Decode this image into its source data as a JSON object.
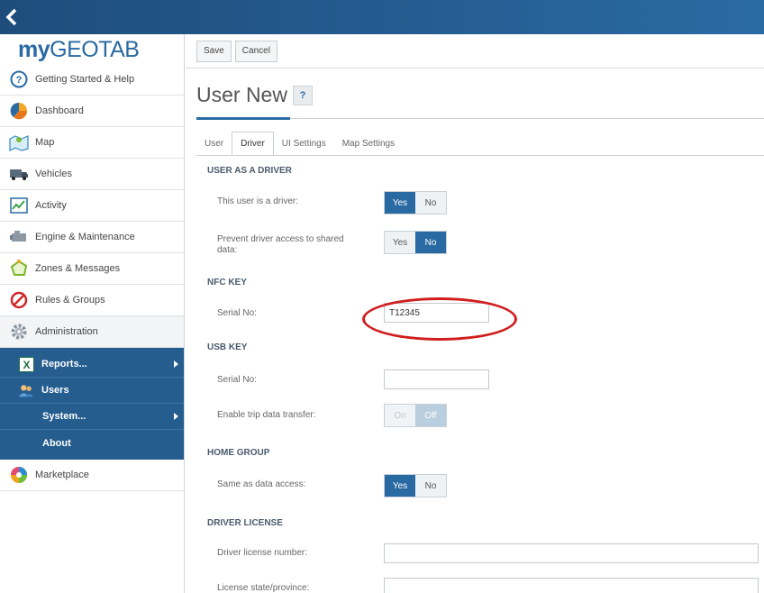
{
  "app": {
    "logo_my": "my",
    "logo_geotab": "GEOTAB"
  },
  "sidebar": {
    "items": [
      {
        "label": "Getting Started & Help",
        "icon": "help-circle-icon"
      },
      {
        "label": "Dashboard",
        "icon": "pie-chart-icon"
      },
      {
        "label": "Map",
        "icon": "map-icon"
      },
      {
        "label": "Vehicles",
        "icon": "truck-icon"
      },
      {
        "label": "Activity",
        "icon": "activity-chart-icon"
      },
      {
        "label": "Engine & Maintenance",
        "icon": "engine-icon"
      },
      {
        "label": "Zones & Messages",
        "icon": "zone-polygon-icon"
      },
      {
        "label": "Rules & Groups",
        "icon": "rules-prohibited-icon"
      },
      {
        "label": "Administration",
        "icon": "gear-icon"
      }
    ],
    "submenu": [
      {
        "label": "Reports...",
        "icon": "excel-icon",
        "has_arrow": true
      },
      {
        "label": "Users",
        "icon": "users-icon",
        "has_arrow": false
      },
      {
        "label": "System...",
        "has_arrow": true
      },
      {
        "label": "About",
        "has_arrow": false
      }
    ],
    "marketplace": "Marketplace"
  },
  "toolbar": {
    "save_label": "Save",
    "cancel_label": "Cancel"
  },
  "page": {
    "title": "User New",
    "help": "?"
  },
  "tabs": [
    {
      "label": "User"
    },
    {
      "label": "Driver",
      "active": true
    },
    {
      "label": "UI Settings"
    },
    {
      "label": "Map Settings"
    }
  ],
  "form": {
    "driver_section": "USER AS A DRIVER",
    "is_driver_label": "This user is a driver:",
    "is_driver": {
      "yes": "Yes",
      "no": "No",
      "selected": "Yes"
    },
    "prevent_access_label": "Prevent driver access to shared data:",
    "prevent_access": {
      "yes": "Yes",
      "no": "No",
      "selected": "No"
    },
    "nfc_section": "NFC KEY",
    "nfc_serial_label": "Serial No:",
    "nfc_serial_value": "T12345",
    "usb_section": "USB KEY",
    "usb_serial_label": "Serial No:",
    "usb_serial_value": "",
    "trip_transfer_label": "Enable trip data transfer:",
    "trip_transfer": {
      "on": "On",
      "off": "Off",
      "selected": "Off",
      "disabled": true
    },
    "home_section": "HOME GROUP",
    "same_access_label": "Same as data access:",
    "same_access": {
      "yes": "Yes",
      "no": "No",
      "selected": "Yes"
    },
    "license_section": "DRIVER LICENSE",
    "license_number_label": "Driver license number:",
    "license_state_label": "License state/province:"
  },
  "colors": {
    "brand_blue": "#2a6aa3",
    "submenu_bg": "#255d8f",
    "annotation_red": "#d01e1e"
  }
}
